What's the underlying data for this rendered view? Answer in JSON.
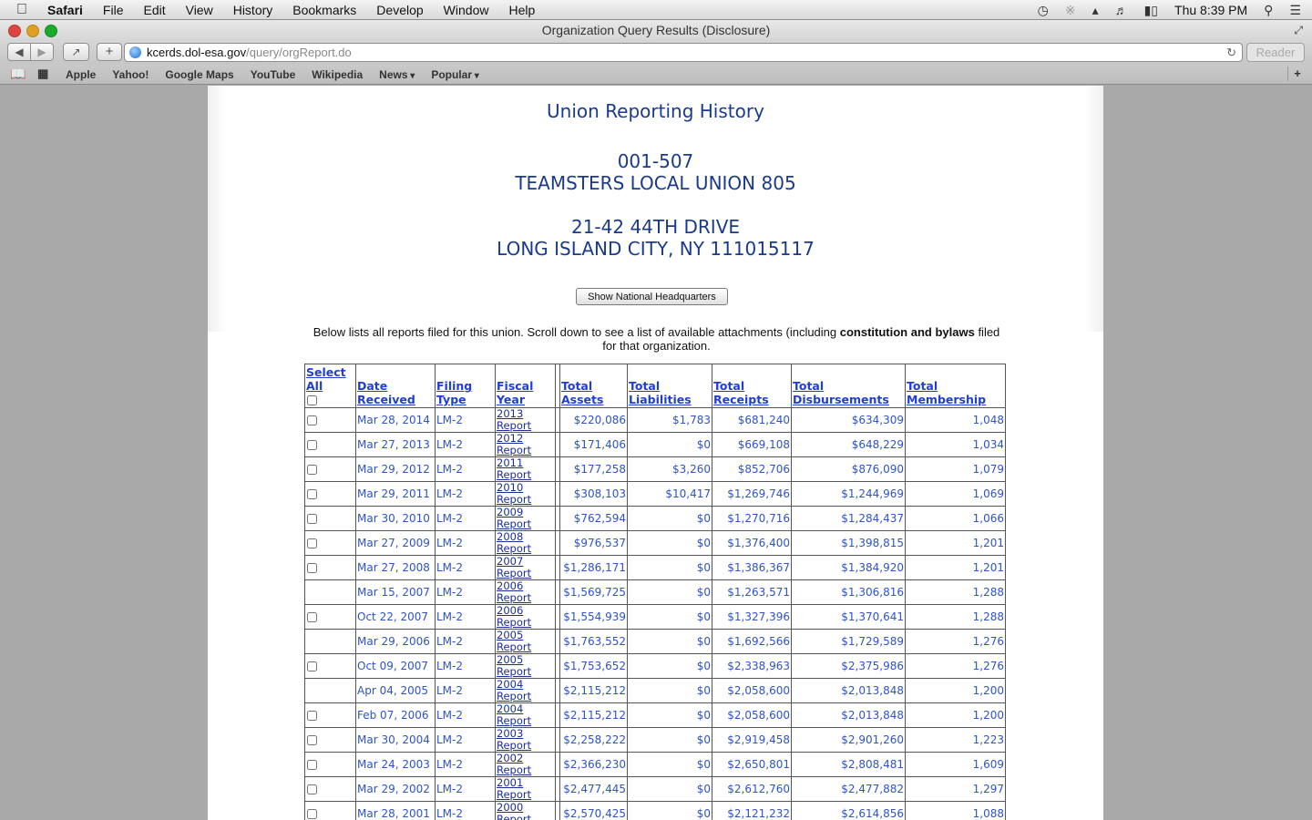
{
  "menubar": {
    "app": "Safari",
    "items": [
      "File",
      "Edit",
      "View",
      "History",
      "Bookmarks",
      "Develop",
      "Window",
      "Help"
    ],
    "clock": "Thu 8:39 PM"
  },
  "window": {
    "title": "Organization Query Results (Disclosure)",
    "url_host": "kcerds.dol-esa.gov",
    "url_path": "/query/orgReport.do",
    "reader_label": "Reader"
  },
  "bookmarks": {
    "items": [
      {
        "label": "Apple",
        "dropdown": false
      },
      {
        "label": "Yahoo!",
        "dropdown": false
      },
      {
        "label": "Google Maps",
        "dropdown": false
      },
      {
        "label": "YouTube",
        "dropdown": false
      },
      {
        "label": "Wikipedia",
        "dropdown": false
      },
      {
        "label": "News",
        "dropdown": true
      },
      {
        "label": "Popular",
        "dropdown": true
      }
    ]
  },
  "page": {
    "title": "Union Reporting History",
    "file_number": "001-507",
    "union_name": "TEAMSTERS LOCAL UNION 805",
    "address_line1": "21-42 44TH DRIVE",
    "address_line2": "LONG ISLAND CITY, NY 111015117",
    "hq_button": "Show National Headquarters",
    "intro_before": "Below lists all reports filed for this union. Scroll down to see a list of available attachments (including ",
    "intro_bold": "constitution and bylaws",
    "intro_after": " filed for that organization."
  },
  "table": {
    "headers": {
      "select": [
        "Select",
        "All"
      ],
      "date": [
        "Date",
        "Received"
      ],
      "filing": [
        "Filing",
        "Type"
      ],
      "fiscal": [
        "Fiscal",
        "Year"
      ],
      "assets": [
        "Total",
        "Assets"
      ],
      "liabilities": [
        "Total",
        "Liabilities"
      ],
      "receipts": [
        "Total",
        "Receipts"
      ],
      "disbursements": [
        "Total",
        "Disbursements"
      ],
      "membership": [
        "Total",
        "Membership"
      ]
    },
    "report_label": "Report",
    "rows": [
      {
        "checkbox": true,
        "date": "Mar 28, 2014",
        "type": "LM-2",
        "year": "2013",
        "assets": "$220,086",
        "liabilities": "$1,783",
        "receipts": "$681,240",
        "disbursements": "$634,309",
        "membership": "1,048"
      },
      {
        "checkbox": true,
        "date": "Mar 27, 2013",
        "type": "LM-2",
        "year": "2012",
        "assets": "$171,406",
        "liabilities": "$0",
        "receipts": "$669,108",
        "disbursements": "$648,229",
        "membership": "1,034"
      },
      {
        "checkbox": true,
        "date": "Mar 29, 2012",
        "type": "LM-2",
        "year": "2011",
        "assets": "$177,258",
        "liabilities": "$3,260",
        "receipts": "$852,706",
        "disbursements": "$876,090",
        "membership": "1,079"
      },
      {
        "checkbox": true,
        "date": "Mar 29, 2011",
        "type": "LM-2",
        "year": "2010",
        "assets": "$308,103",
        "liabilities": "$10,417",
        "receipts": "$1,269,746",
        "disbursements": "$1,244,969",
        "membership": "1,069"
      },
      {
        "checkbox": true,
        "date": "Mar 30, 2010",
        "type": "LM-2",
        "year": "2009",
        "assets": "$762,594",
        "liabilities": "$0",
        "receipts": "$1,270,716",
        "disbursements": "$1,284,437",
        "membership": "1,066"
      },
      {
        "checkbox": true,
        "date": "Mar 27, 2009",
        "type": "LM-2",
        "year": "2008",
        "assets": "$976,537",
        "liabilities": "$0",
        "receipts": "$1,376,400",
        "disbursements": "$1,398,815",
        "membership": "1,201"
      },
      {
        "checkbox": true,
        "date": "Mar 27, 2008",
        "type": "LM-2",
        "year": "2007",
        "assets": "$1,286,171",
        "liabilities": "$0",
        "receipts": "$1,386,367",
        "disbursements": "$1,384,920",
        "membership": "1,201"
      },
      {
        "checkbox": false,
        "date": "Mar 15, 2007",
        "type": "LM-2",
        "year": "2006",
        "assets": "$1,569,725",
        "liabilities": "$0",
        "receipts": "$1,263,571",
        "disbursements": "$1,306,816",
        "membership": "1,288"
      },
      {
        "checkbox": true,
        "date": "Oct 22, 2007",
        "type": "LM-2",
        "year": "2006",
        "assets": "$1,554,939",
        "liabilities": "$0",
        "receipts": "$1,327,396",
        "disbursements": "$1,370,641",
        "membership": "1,288"
      },
      {
        "checkbox": false,
        "date": "Mar 29, 2006",
        "type": "LM-2",
        "year": "2005",
        "assets": "$1,763,552",
        "liabilities": "$0",
        "receipts": "$1,692,566",
        "disbursements": "$1,729,589",
        "membership": "1,276"
      },
      {
        "checkbox": true,
        "date": "Oct 09, 2007",
        "type": "LM-2",
        "year": "2005",
        "assets": "$1,753,652",
        "liabilities": "$0",
        "receipts": "$2,338,963",
        "disbursements": "$2,375,986",
        "membership": "1,276"
      },
      {
        "checkbox": false,
        "date": "Apr 04, 2005",
        "type": "LM-2",
        "year": "2004",
        "assets": "$2,115,212",
        "liabilities": "$0",
        "receipts": "$2,058,600",
        "disbursements": "$2,013,848",
        "membership": "1,200"
      },
      {
        "checkbox": true,
        "date": "Feb 07, 2006",
        "type": "LM-2",
        "year": "2004",
        "assets": "$2,115,212",
        "liabilities": "$0",
        "receipts": "$2,058,600",
        "disbursements": "$2,013,848",
        "membership": "1,200"
      },
      {
        "checkbox": true,
        "date": "Mar 30, 2004",
        "type": "LM-2",
        "year": "2003",
        "assets": "$2,258,222",
        "liabilities": "$0",
        "receipts": "$2,919,458",
        "disbursements": "$2,901,260",
        "membership": "1,223"
      },
      {
        "checkbox": true,
        "date": "Mar 24, 2003",
        "type": "LM-2",
        "year": "2002",
        "assets": "$2,366,230",
        "liabilities": "$0",
        "receipts": "$2,650,801",
        "disbursements": "$2,808,481",
        "membership": "1,609"
      },
      {
        "checkbox": true,
        "date": "Mar 29, 2002",
        "type": "LM-2",
        "year": "2001",
        "assets": "$2,477,445",
        "liabilities": "$0",
        "receipts": "$2,612,760",
        "disbursements": "$2,477,882",
        "membership": "1,297"
      },
      {
        "checkbox": true,
        "date": "Mar 28, 2001",
        "type": "LM-2",
        "year": "2000",
        "assets": "$2,570,425",
        "liabilities": "$0",
        "receipts": "$2,121,232",
        "disbursements": "$2,614,856",
        "membership": "1,088"
      }
    ]
  },
  "colors": {
    "heading_blue": "#1a3a8c",
    "cell_blue": "#2e54c6",
    "link_blue": "#1f3fd1"
  }
}
